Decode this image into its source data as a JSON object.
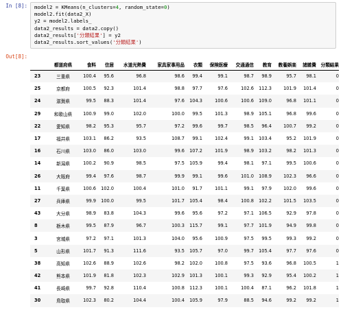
{
  "input_prompt": "In [8]:",
  "output_prompt": "Out[8]:",
  "code": {
    "line1": {
      "a": "model2 = KMeans(n_clusters=",
      "n1": "4",
      "b": ", random_state=",
      "n2": "0",
      "c": ")"
    },
    "line2": "model2.fit(data2_X)",
    "line3": "y2 = model2.labels_",
    "line4": "data2_results = data2.copy()",
    "line5": {
      "a": "data2_results[",
      "s": "'分類結果'",
      "b": "] = y2"
    },
    "line6": {
      "a": "data2_results.sort_values(",
      "s": "'分類結果'",
      "b": ")"
    }
  },
  "table": {
    "columns": [
      "都道府県",
      "食料",
      "住居",
      "水道光熱費",
      "家具家事用品",
      "衣類",
      "保険医療",
      "交通通信",
      "教育",
      "教養娯楽",
      "諸雑費",
      "分類結果"
    ],
    "rows": [
      {
        "index": "23",
        "cells": [
          "三重県",
          "100.4",
          "95.6",
          "96.8",
          "98.6",
          "99.4",
          "99.1",
          "98.7",
          "98.9",
          "95.7",
          "98.1",
          "0"
        ]
      },
      {
        "index": "25",
        "cells": [
          "京都府",
          "100.5",
          "92.3",
          "101.4",
          "98.8",
          "97.7",
          "97.6",
          "102.6",
          "112.3",
          "101.9",
          "101.4",
          "0"
        ]
      },
      {
        "index": "24",
        "cells": [
          "滋賀県",
          "99.5",
          "88.3",
          "101.4",
          "97.6",
          "104.3",
          "100.6",
          "100.6",
          "109.0",
          "96.8",
          "101.1",
          "0"
        ]
      },
      {
        "index": "29",
        "cells": [
          "和歌山県",
          "100.9",
          "99.0",
          "102.0",
          "100.0",
          "99.5",
          "101.3",
          "98.9",
          "105.1",
          "96.8",
          "99.6",
          "0"
        ]
      },
      {
        "index": "22",
        "cells": [
          "愛知県",
          "98.2",
          "95.3",
          "95.7",
          "97.2",
          "99.6",
          "99.7",
          "98.5",
          "96.4",
          "100.7",
          "99.2",
          "0"
        ]
      },
      {
        "index": "17",
        "cells": [
          "福井県",
          "103.1",
          "86.2",
          "93.5",
          "108.7",
          "99.1",
          "102.4",
          "99.1",
          "103.4",
          "95.2",
          "101.9",
          "0"
        ]
      },
      {
        "index": "16",
        "cells": [
          "石川県",
          "103.0",
          "86.0",
          "103.0",
          "99.6",
          "107.2",
          "101.9",
          "98.9",
          "103.2",
          "98.2",
          "101.3",
          "0"
        ]
      },
      {
        "index": "14",
        "cells": [
          "新潟県",
          "100.2",
          "90.9",
          "98.5",
          "97.5",
          "105.9",
          "99.4",
          "98.1",
          "97.1",
          "99.5",
          "100.6",
          "0"
        ]
      },
      {
        "index": "26",
        "cells": [
          "大阪府",
          "99.4",
          "97.6",
          "98.7",
          "99.9",
          "99.1",
          "99.6",
          "101.0",
          "108.9",
          "102.3",
          "96.6",
          "0"
        ]
      },
      {
        "index": "11",
        "cells": [
          "千葉県",
          "100.6",
          "102.0",
          "100.4",
          "101.0",
          "91.7",
          "101.1",
          "99.1",
          "97.9",
          "102.0",
          "99.6",
          "0"
        ]
      },
      {
        "index": "27",
        "cells": [
          "兵庫県",
          "99.9",
          "100.0",
          "99.5",
          "101.7",
          "105.4",
          "98.4",
          "100.8",
          "102.2",
          "101.5",
          "103.5",
          "0"
        ]
      },
      {
        "index": "43",
        "cells": [
          "大分県",
          "98.9",
          "83.8",
          "104.3",
          "99.6",
          "95.6",
          "97.2",
          "97.1",
          "106.5",
          "92.9",
          "97.8",
          "0"
        ]
      },
      {
        "index": "8",
        "cells": [
          "栃木県",
          "99.5",
          "87.9",
          "96.7",
          "100.3",
          "115.7",
          "99.1",
          "97.7",
          "101.9",
          "94.9",
          "99.8",
          "0"
        ]
      },
      {
        "index": "3",
        "cells": [
          "宮城県",
          "97.2",
          "97.1",
          "101.3",
          "104.0",
          "95.6",
          "100.9",
          "97.5",
          "99.5",
          "99.3",
          "99.2",
          "0"
        ]
      },
      {
        "index": "5",
        "cells": [
          "山形県",
          "101.7",
          "91.3",
          "111.6",
          "93.5",
          "105.7",
          "97.0",
          "99.7",
          "105.4",
          "97.7",
          "97.6",
          "0"
        ]
      },
      {
        "index": "38",
        "cells": [
          "高知県",
          "102.6",
          "88.9",
          "102.6",
          "98.2",
          "102.0",
          "100.8",
          "97.5",
          "93.6",
          "96.8",
          "100.5",
          "1"
        ]
      },
      {
        "index": "42",
        "cells": [
          "熊本県",
          "101.9",
          "81.8",
          "102.3",
          "102.9",
          "101.3",
          "100.1",
          "99.3",
          "92.9",
          "95.4",
          "100.2",
          "1"
        ]
      },
      {
        "index": "41",
        "cells": [
          "長崎県",
          "99.7",
          "92.8",
          "110.4",
          "100.8",
          "112.3",
          "100.1",
          "100.4",
          "87.1",
          "96.2",
          "101.8",
          "1"
        ]
      },
      {
        "index": "30",
        "cells": [
          "鳥取県",
          "102.3",
          "80.2",
          "104.4",
          "100.4",
          "105.9",
          "97.9",
          "88.5",
          "94.6",
          "99.2",
          "99.2",
          "1"
        ]
      }
    ]
  }
}
